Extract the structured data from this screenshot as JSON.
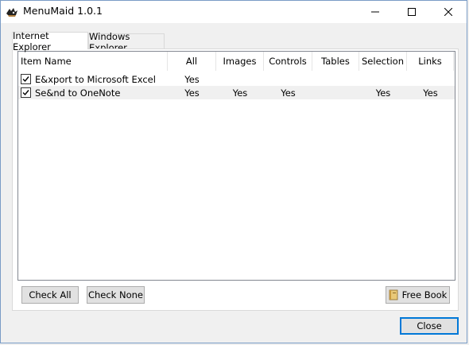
{
  "window": {
    "title": "MenuMaid 1.0.1",
    "app_icon": "menumaid-app-icon",
    "controls": [
      "minimize-icon",
      "maximize-icon",
      "close-icon"
    ]
  },
  "tabs": [
    {
      "label": "Internet Explorer",
      "active": true
    },
    {
      "label": "Windows Explorer",
      "active": false
    }
  ],
  "table": {
    "columns": [
      "Item Name",
      "All",
      "Images",
      "Controls",
      "Tables",
      "Selection",
      "Links"
    ],
    "rows": [
      {
        "checked": true,
        "name": "E&xport to Microsoft Excel",
        "all": "Yes",
        "images": "",
        "controls": "",
        "tables": "",
        "selection": "",
        "links": ""
      },
      {
        "checked": true,
        "name": "Se&nd to OneNote",
        "all": "Yes",
        "images": "Yes",
        "controls": "Yes",
        "tables": "",
        "selection": "Yes",
        "links": "Yes"
      }
    ]
  },
  "buttons": {
    "check_all": "Check All",
    "check_none": "Check None",
    "free_book": "Free Book",
    "close": "Close"
  }
}
